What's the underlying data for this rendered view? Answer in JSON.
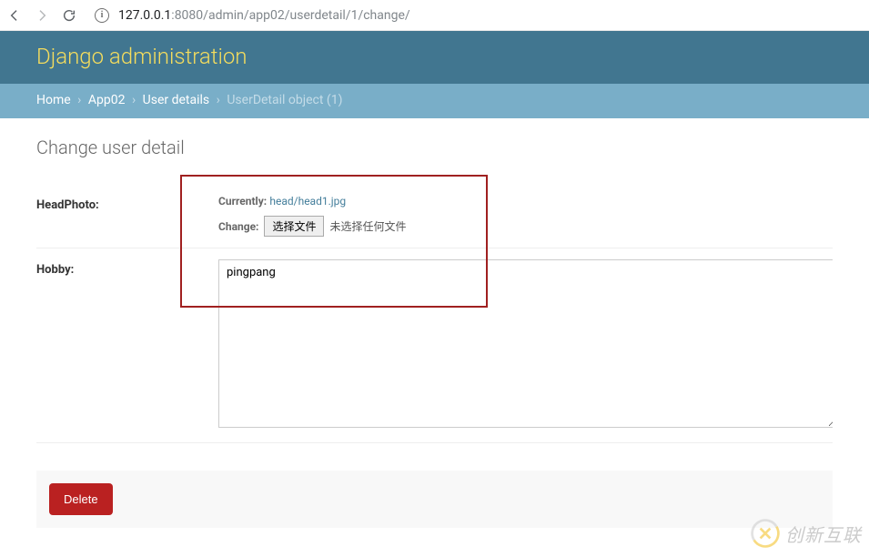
{
  "browser": {
    "url_host": "127.0.0.1",
    "url_port": ":8080",
    "url_path": "/admin/app02/userdetail/1/change/"
  },
  "header": {
    "branding": "Django administration"
  },
  "breadcrumbs": {
    "home": "Home",
    "app": "App02",
    "model": "User details",
    "current": "UserDetail object (1)",
    "sep": "›"
  },
  "page": {
    "title": "Change user detail"
  },
  "fields": {
    "headphoto": {
      "label": "HeadPhoto:",
      "currently_label": "Currently:",
      "currently_value": "head/head1.jpg",
      "change_label": "Change:",
      "file_button": "选择文件",
      "file_status": "未选择任何文件"
    },
    "hobby": {
      "label": "Hobby:",
      "value": "pingpang"
    }
  },
  "actions": {
    "delete": "Delete"
  },
  "watermark": {
    "text": "创新互联"
  }
}
